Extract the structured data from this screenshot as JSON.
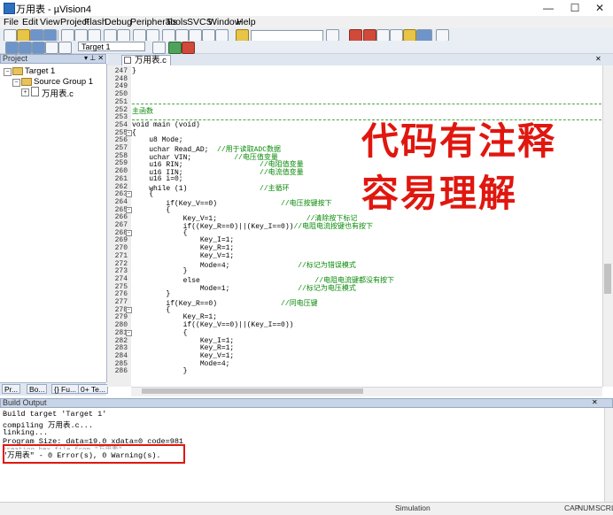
{
  "window": {
    "title": "万用表 - µVision4",
    "minimize": "—",
    "maximize": "☐",
    "close": "✕"
  },
  "menu": [
    "File",
    "Edit",
    "View",
    "Project",
    "Flash",
    "Debug",
    "Peripherals",
    "Tools",
    "SVCS",
    "Window",
    "Help"
  ],
  "toolbar": {
    "target_select": "Target 1"
  },
  "project_panel": {
    "title": "Project",
    "tree": {
      "target": "Target 1",
      "group": "Source Group 1",
      "file": "万用表.c"
    },
    "tabs": [
      "Pr...",
      "Bo...",
      "{} Fu...",
      "0+ Te..."
    ]
  },
  "editor": {
    "tab": "万用表.c",
    "lines": [
      {
        "n": "247",
        "text": "}"
      },
      {
        "n": "248",
        "text": ""
      },
      {
        "n": "249",
        "text": ""
      },
      {
        "n": "250",
        "text": ""
      },
      {
        "n": "251",
        "text": ""
      },
      {
        "n": "252",
        "text": "",
        "comment": "主函数"
      },
      {
        "n": "253",
        "text": ""
      },
      {
        "n": "254",
        "text": "void main (void)"
      },
      {
        "n": "255",
        "text": "{"
      },
      {
        "n": "256",
        "text": "    u8 Mode;"
      },
      {
        "n": "257",
        "text": "    uchar Read_AD;",
        "comment": "  //用于读取ADC数据"
      },
      {
        "n": "258",
        "text": "    uchar VIN;",
        "comment": "          //电压值变量"
      },
      {
        "n": "259",
        "text": "    u16 RIN;",
        "comment": "                  //电阻值变量"
      },
      {
        "n": "260",
        "text": "    u16 IIN;",
        "comment": "                  //电流值变量"
      },
      {
        "n": "261",
        "text": "    u16 i=0;"
      },
      {
        "n": "262",
        "text": "    while (1)",
        "comment": "                 //主循环"
      },
      {
        "n": "263",
        "text": "    {"
      },
      {
        "n": "264",
        "text": "        if(Key_V==0)",
        "comment": "               //电压按键按下"
      },
      {
        "n": "265",
        "text": "        {"
      },
      {
        "n": "266",
        "text": "            Key_V=1;",
        "comment": "                     //清除按下标记"
      },
      {
        "n": "267",
        "text": "            if((Key_R==0)||(Key_I==0))",
        "comment": "//电阻电流按键也有按下"
      },
      {
        "n": "268",
        "text": "            {"
      },
      {
        "n": "269",
        "text": "                Key_I=1;"
      },
      {
        "n": "270",
        "text": "                Key_R=1;"
      },
      {
        "n": "271",
        "text": "                Key_V=1;"
      },
      {
        "n": "272",
        "text": "                Mode=4;",
        "comment": "                //标记为错误模式"
      },
      {
        "n": "273",
        "text": "            }"
      },
      {
        "n": "274",
        "text": "            else",
        "comment": "                           //电阻电流键都没有按下"
      },
      {
        "n": "275",
        "text": "                Mode=1;",
        "comment": "                //标记为电压模式"
      },
      {
        "n": "276",
        "text": "        }"
      },
      {
        "n": "277",
        "text": "        if(Key_R==0)",
        "comment": "               //同电压键"
      },
      {
        "n": "278",
        "text": "        {"
      },
      {
        "n": "279",
        "text": "            Key_R=1;"
      },
      {
        "n": "280",
        "text": "            if((Key_V==0)||(Key_I==0))"
      },
      {
        "n": "281",
        "text": "            {"
      },
      {
        "n": "282",
        "text": "                Key_I=1;"
      },
      {
        "n": "283",
        "text": "                Key_R=1;"
      },
      {
        "n": "284",
        "text": "                Key_V=1;"
      },
      {
        "n": "285",
        "text": "                Mode=4;"
      },
      {
        "n": "286",
        "text": "            }"
      }
    ]
  },
  "overlay": {
    "line1": "代码有注释",
    "line2": "容易理解"
  },
  "build_output": {
    "title": "Build Output",
    "lines": [
      "Build target 'Target 1'",
      "compiling 万用表.c...",
      "linking...",
      "Program Size: data=19.0 xdata=0 code=981",
      "creating hex file from \"万用表\"...",
      "\"万用表\" - 0 Error(s), 0 Warning(s)."
    ]
  },
  "status": {
    "mode": "Simulation",
    "cap": "CAP",
    "num": "NUM",
    "scrl": "SCRL"
  }
}
